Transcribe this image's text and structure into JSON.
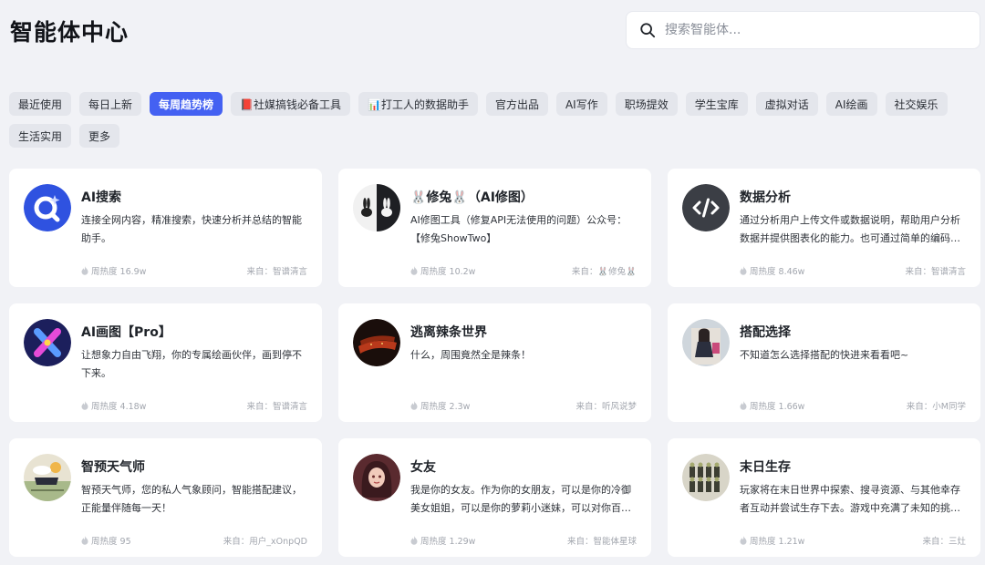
{
  "page": {
    "title": "智能体中心",
    "search_placeholder": "搜索智能体..."
  },
  "tabs": [
    {
      "label": "最近使用",
      "active": false
    },
    {
      "label": "每日上新",
      "active": false
    },
    {
      "label": "每周趋势榜",
      "active": true
    },
    {
      "label": "📕社媒搞钱必备工具",
      "active": false
    },
    {
      "label": "📊打工人的数据助手",
      "active": false
    },
    {
      "label": "官方出品",
      "active": false
    },
    {
      "label": "AI写作",
      "active": false
    },
    {
      "label": "职场提效",
      "active": false
    },
    {
      "label": "学生宝库",
      "active": false
    },
    {
      "label": "虚拟对话",
      "active": false
    },
    {
      "label": "AI绘画",
      "active": false
    },
    {
      "label": "社交娱乐",
      "active": false
    },
    {
      "label": "生活实用",
      "active": false
    },
    {
      "label": "更多",
      "active": false
    }
  ],
  "cards": [
    {
      "name": "AI搜索",
      "desc": "连接全网内容，精准搜索，快速分析并总结的智能助手。",
      "heat": "周热度 16.9w",
      "source": "来自：智谱清言",
      "avatar": "search-agent-icon"
    },
    {
      "name": "🐰修兔🐰（AI修图）",
      "desc": "AI修图工具（修复API无法使用的问题）公众号：【修兔ShowTwo】",
      "heat": "周热度 10.2w",
      "source": "来自：🐰修兔🐰",
      "avatar": "rabbit-icon"
    },
    {
      "name": "数据分析",
      "desc": "通过分析用户上传文件或数据说明，帮助用户分析数据并提供图表化的能力。也可通过简单的编码完成文件处理的工作。",
      "heat": "周热度 8.46w",
      "source": "来自：智谱清言",
      "avatar": "code-icon"
    },
    {
      "name": "AI画图【Pro】",
      "desc": "让想象力自由飞翔，你的专属绘画伙伴，画到停不下来。",
      "heat": "周热度 4.18w",
      "source": "来自：智谱清言",
      "avatar": "paint-x-icon"
    },
    {
      "name": "逃离辣条世界",
      "desc": "什么，周围竟然全是辣条！",
      "heat": "周热度 2.3w",
      "source": "来自：听风说梦",
      "avatar": "spicy-strip-image"
    },
    {
      "name": "搭配选择",
      "desc": "不知道怎么选择搭配的快进来看看吧~",
      "heat": "周热度 1.66w",
      "source": "来自：小M同学",
      "avatar": "fashion-girl-image"
    },
    {
      "name": "智预天气师",
      "desc": "智预天气师，您的私人气象顾问，智能搭配建议，正能量伴随每一天！",
      "heat": "周热度 95",
      "source": "来自：用户_xOnpQD",
      "avatar": "weather-image"
    },
    {
      "name": "女友",
      "desc": "我是你的女友。作为你的女朋友，可以是你的冷御美女姐姐，可以是你的萝莉小迷妹，可以对你百依百顺。",
      "heat": "周热度 1.29w",
      "source": "来自：智能体星球",
      "avatar": "girlfriend-image"
    },
    {
      "name": "末日生存",
      "desc": "玩家将在末日世界中探索、搜寻资源、与其他幸存者互动并尝试生存下去。游戏中充满了未知的挑战。",
      "heat": "周热度 1.21w",
      "source": "来自：三灶",
      "avatar": "survival-image"
    }
  ],
  "colors": {
    "accent": "#4461f2",
    "background": "#f1f2f6",
    "card": "#ffffff"
  }
}
